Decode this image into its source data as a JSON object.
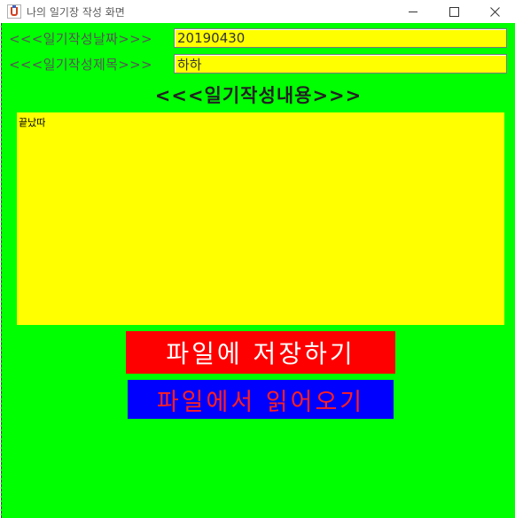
{
  "window": {
    "title": "나의 일기장 작성 화면",
    "controls": {
      "minimize": "minimize-icon",
      "maximize": "maximize-icon",
      "close": "close-icon"
    }
  },
  "form": {
    "date_label": "<<<일기작성날짜>>>",
    "date_value": "20190430",
    "subject_label": "<<<일기작성제목>>>",
    "subject_value": "하하",
    "content_title": "<<<일기작성내용>>>",
    "content_value": "끝났따"
  },
  "buttons": {
    "save_label": "파일에 저장하기",
    "load_label": "파일에서 읽어오기"
  },
  "colors": {
    "background": "#00ff00",
    "field": "#ffff00",
    "save_button": "#ff0000",
    "save_text": "#ffffff",
    "load_button": "#0000ff",
    "load_text": "#ff2020"
  }
}
